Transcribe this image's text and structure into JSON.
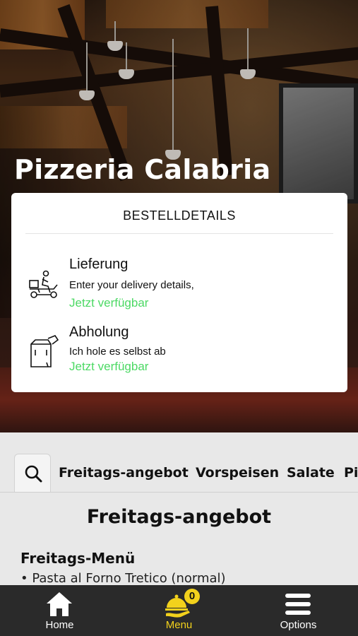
{
  "restaurant": {
    "name": "Pizzeria Calabria"
  },
  "order_details": {
    "title": "BESTELLDETAILS",
    "options": [
      {
        "icon": "delivery-scooter-icon",
        "title": "Lieferung",
        "subtitle": "Enter your delivery details,",
        "status": "Jetzt verfügbar"
      },
      {
        "icon": "takeaway-bag-icon",
        "title": "Abholung",
        "subtitle": "Ich hole es selbst ab",
        "status": "Jetzt verfügbar"
      }
    ],
    "status_color": "#4cd964"
  },
  "categories": {
    "search_icon": "search-icon",
    "items": [
      {
        "label": "Freitags-angebot"
      },
      {
        "label": "Vorspeisen"
      },
      {
        "label": "Salate"
      },
      {
        "label": "Pi"
      }
    ]
  },
  "menu_section": {
    "title": "Freitags-angebot",
    "subsection": "Freitags-Menü",
    "items": [
      "• Pasta al Forno Tretico (normal)"
    ]
  },
  "bottom_nav": {
    "items": [
      {
        "label": "Home",
        "icon": "home-icon",
        "active": false
      },
      {
        "label": "Menu",
        "icon": "cloche-icon",
        "active": true,
        "badge": "0"
      },
      {
        "label": "Options",
        "icon": "hamburger-menu-icon",
        "active": false
      }
    ],
    "active_color": "#f2d11c"
  }
}
